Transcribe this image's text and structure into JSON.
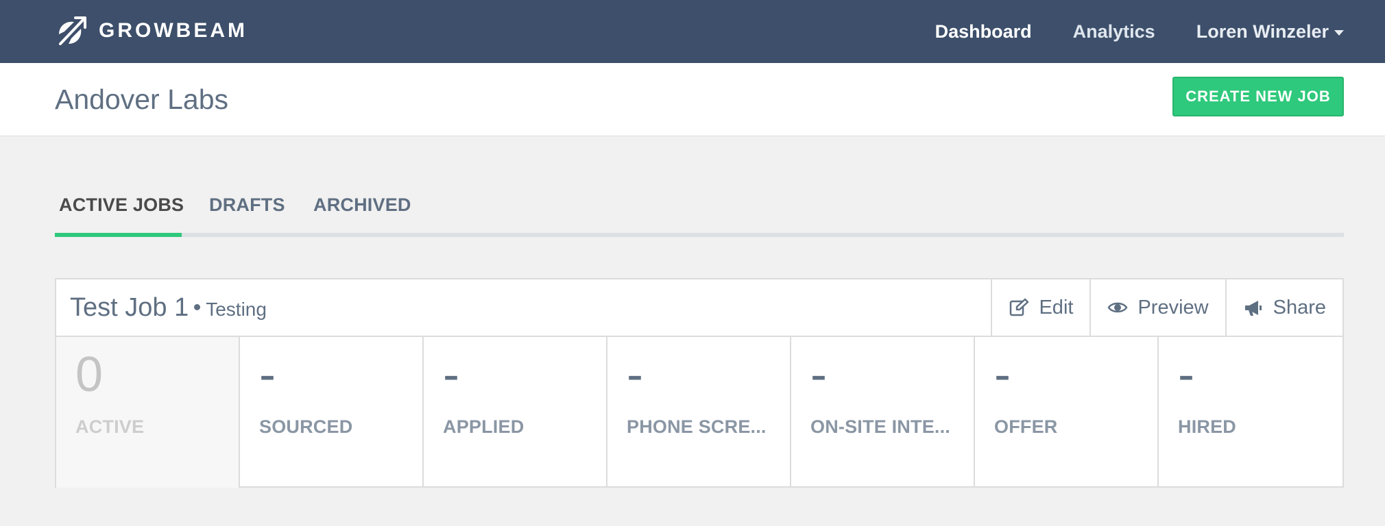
{
  "nav": {
    "brand": "GROWBEAM",
    "links": [
      "Dashboard",
      "Analytics"
    ],
    "user": "Loren Winzeler"
  },
  "header": {
    "title": "Andover Labs",
    "create_button": "CREATE NEW JOB"
  },
  "tabs": [
    "ACTIVE JOBS",
    "DRAFTS",
    "ARCHIVED"
  ],
  "job": {
    "title": "Test Job 1",
    "subtitle": "Testing",
    "actions": {
      "edit": "Edit",
      "preview": "Preview",
      "share": "Share"
    },
    "stats": [
      {
        "value": "0",
        "label": "ACTIVE"
      },
      {
        "value": "-",
        "label": "SOURCED"
      },
      {
        "value": "-",
        "label": "APPLIED"
      },
      {
        "value": "-",
        "label": "PHONE SCRE..."
      },
      {
        "value": "-",
        "label": "ON-SITE INTE..."
      },
      {
        "value": "-",
        "label": "OFFER"
      },
      {
        "value": "-",
        "label": "HIRED"
      }
    ]
  },
  "colors": {
    "nav_bg": "#3d4f6a",
    "accent": "#2ec97c",
    "text": "#5f6f82"
  }
}
